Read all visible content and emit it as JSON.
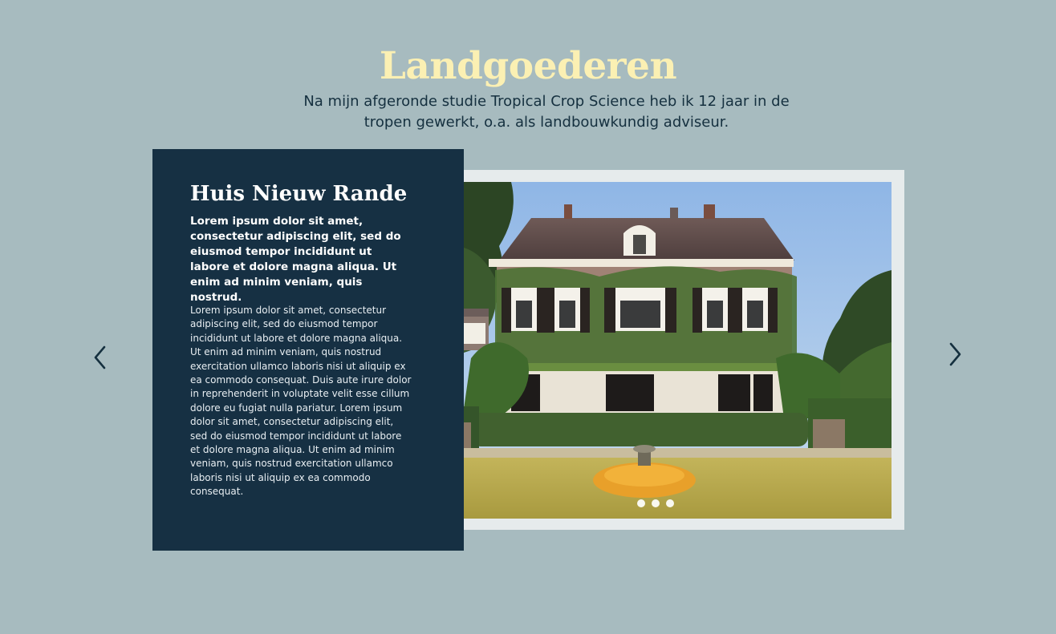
{
  "header": {
    "title": "Landgoederen",
    "intro": "Na mijn afgeronde studie Tropical Crop Science heb ik 12 jaar in de tropen gewerkt, o.a. als landbouwkundig adviseur."
  },
  "slide": {
    "title": "Huis Nieuw Rande",
    "lead": "Lorem ipsum dolor sit amet, consectetur adipiscing elit, sed do eiusmod tempor incididunt ut labore et dolore magna aliqua. Ut enim ad minim veniam, quis nostrud.",
    "body": "Lorem ipsum dolor sit amet, consectetur adipiscing elit, sed do eiusmod tempor incididunt ut labore et dolore magna aliqua. Ut enim ad minim veniam, quis nostrud exercitation ullamco laboris nisi ut aliquip ex ea commodo consequat. Duis aute irure dolor in reprehenderit in voluptate velit esse cillum dolore eu fugiat nulla pariatur. Lorem ipsum dolor sit amet, consectetur adipiscing elit, sed do eiusmod tempor incididunt ut labore et dolore magna aliqua. Ut enim ad minim veniam, quis nostrud exercitation ullamco laboris nisi ut aliquip ex ea commodo consequat."
  },
  "carousel": {
    "prev_icon": "chevron-left-icon",
    "next_icon": "chevron-right-icon",
    "dot_count": 3
  },
  "colors": {
    "background": "#a7bbbf",
    "title": "#fbf0b3",
    "panel": "#163043",
    "frame": "#e6ebec",
    "text_dark": "#15303f"
  }
}
